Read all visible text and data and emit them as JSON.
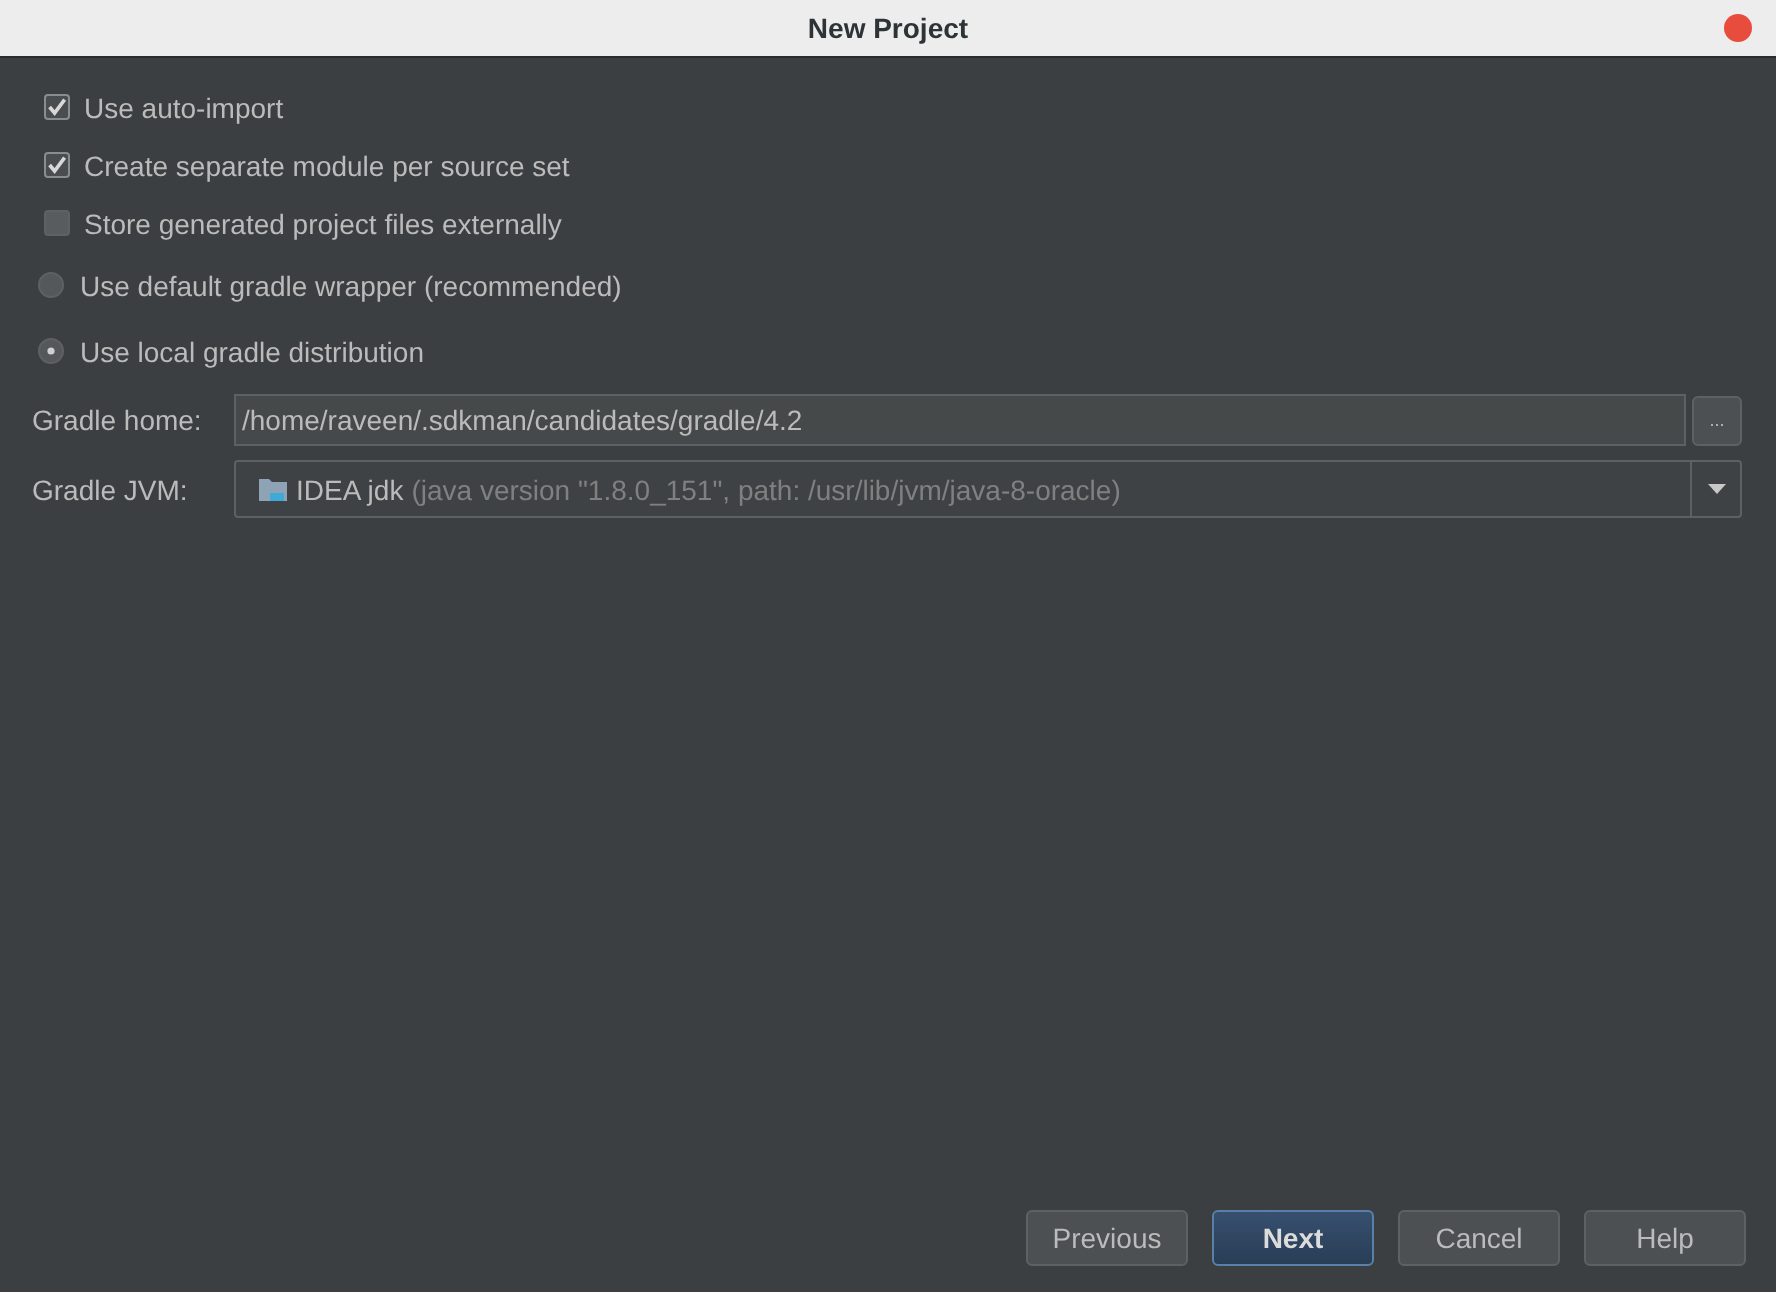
{
  "window": {
    "title": "New Project"
  },
  "options": [
    {
      "kind": "checkbox",
      "label": "Use auto-import",
      "checked": true
    },
    {
      "kind": "checkbox",
      "label": "Create separate module per source set",
      "checked": true
    },
    {
      "kind": "checkbox",
      "label": "Store generated project files externally",
      "checked": false
    },
    {
      "kind": "radio",
      "label": "Use default gradle wrapper (recommended)",
      "selected": false
    },
    {
      "kind": "radio",
      "label": "Use local gradle distribution",
      "selected": true
    }
  ],
  "gradle_home": {
    "label": "Gradle home:",
    "value": "/home/raveen/.sdkman/candidates/gradle/4.2",
    "browse_button": "..."
  },
  "gradle_jvm": {
    "label": "Gradle JVM:",
    "value": "IDEA jdk",
    "detail": "(java version \"1.8.0_151\", path: /usr/lib/jvm/java-8-oracle)"
  },
  "buttons": [
    {
      "label": "Previous",
      "default": false
    },
    {
      "label": "Next",
      "default": true
    },
    {
      "label": "Cancel",
      "default": false
    },
    {
      "label": "Help",
      "default": false
    }
  ]
}
